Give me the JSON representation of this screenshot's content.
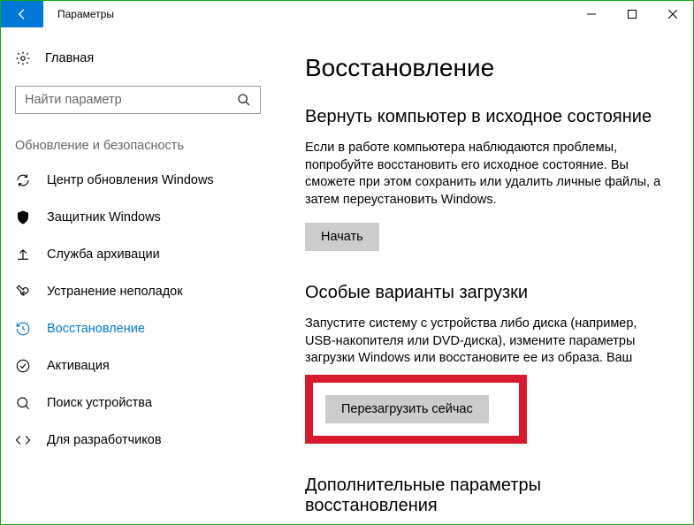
{
  "titlebar": {
    "app_title": "Параметры"
  },
  "sidebar": {
    "home_label": "Главная",
    "search_placeholder": "Найти параметр",
    "section_label": "Обновление и безопасность",
    "items": [
      {
        "label": "Центр обновления Windows"
      },
      {
        "label": "Защитник Windows"
      },
      {
        "label": "Служба архивации"
      },
      {
        "label": "Устранение неполадок"
      },
      {
        "label": "Восстановление"
      },
      {
        "label": "Активация"
      },
      {
        "label": "Поиск устройства"
      },
      {
        "label": "Для разработчиков"
      }
    ]
  },
  "main": {
    "heading": "Восстановление",
    "reset": {
      "title": "Вернуть компьютер в исходное состояние",
      "desc": "Если в работе компьютера наблюдаются проблемы, попробуйте восстановить его исходное состояние. Вы сможете при этом сохранить или удалить личные файлы, а затем переустановить Windows.",
      "button": "Начать"
    },
    "advanced": {
      "title": "Особые варианты загрузки",
      "desc": "Запустите систему с устройства либо диска (например, USB-накопителя или DVD-диска), измените параметры загрузки Windows или восстановите ее из образа. Ваш",
      "button": "Перезагрузить сейчас"
    },
    "more": {
      "title": "Дополнительные параметры восстановления"
    }
  }
}
